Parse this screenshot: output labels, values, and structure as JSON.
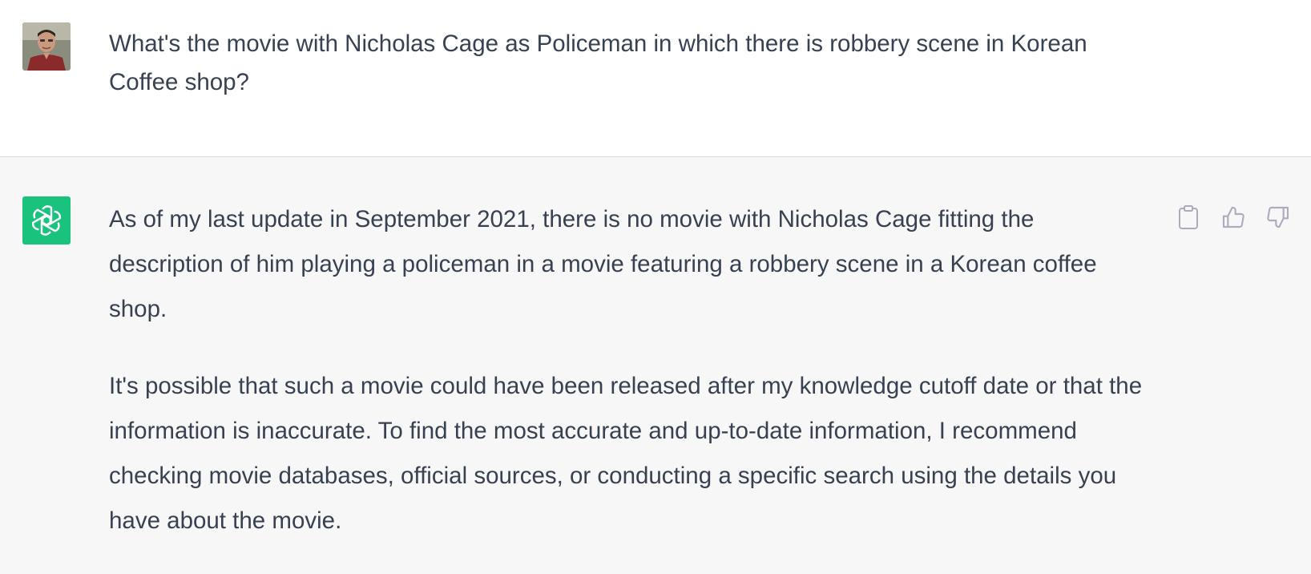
{
  "user_message": {
    "avatar_icon": "user-photo-avatar",
    "text": "What's the movie with Nicholas Cage as Policeman in which there is robbery scene in Korean Coffee shop?"
  },
  "assistant_message": {
    "avatar_icon": "chatgpt-logo-icon",
    "avatar_color": "#19c37d",
    "paragraphs": [
      "As of my last update in September 2021, there is no movie with Nicholas Cage fitting the description of him playing a policeman in a movie featuring a robbery scene in a Korean coffee shop.",
      "It's possible that such a movie could have been released after my knowledge cutoff date or that the information is inaccurate. To find the most accurate and up-to-date information, I recommend checking movie databases, official sources, or conducting a specific search using the details you have about the movie."
    ],
    "actions": [
      {
        "icon": "clipboard-icon"
      },
      {
        "icon": "thumbs-up-icon"
      },
      {
        "icon": "thumbs-down-icon"
      }
    ]
  },
  "colors": {
    "user_bg": "#ffffff",
    "assistant_bg": "#f7f7f8",
    "text": "#374151",
    "icon": "#acacbe"
  }
}
